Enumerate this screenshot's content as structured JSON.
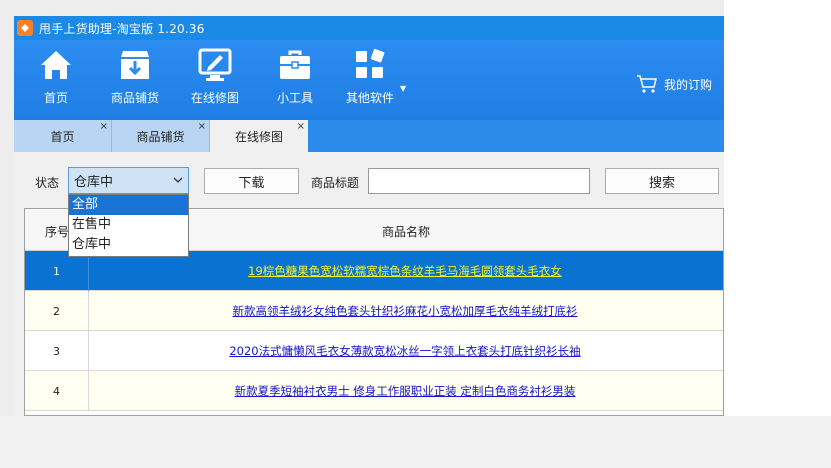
{
  "window": {
    "title": "甩手上货助理-淘宝版 1.20.36"
  },
  "toolbar": {
    "items": [
      {
        "label": "首页",
        "icon": "home-icon"
      },
      {
        "label": "商品铺货",
        "icon": "box-icon"
      },
      {
        "label": "在线修图",
        "icon": "monitor-edit-icon"
      },
      {
        "label": "小工具",
        "icon": "toolbox-icon"
      },
      {
        "label": "其他软件",
        "icon": "apps-icon"
      }
    ],
    "subscription": "我的订购"
  },
  "tabs": [
    {
      "label": "首页",
      "close": "×"
    },
    {
      "label": "商品铺货",
      "close": "×"
    },
    {
      "label": "在线修图",
      "close": "×"
    }
  ],
  "filter": {
    "status_label": "状态",
    "status_value": "仓库中",
    "status_options": [
      "全部",
      "在售中",
      "仓库中"
    ],
    "download_label": "下载",
    "title_label": "商品标题",
    "title_value": "",
    "search_label": "搜索"
  },
  "table": {
    "columns": [
      "序号",
      "商品名称"
    ],
    "rows": [
      {
        "index": "1",
        "name": "19棕色糖果色宽松软糯宽棕色条纹羊毛马海毛圆领套头毛衣女"
      },
      {
        "index": "2",
        "name": "新款高领羊绒衫女纯色套头针织衫麻花小宽松加厚毛衣纯羊绒打底衫"
      },
      {
        "index": "3",
        "name": "2020法式慵懒风毛衣女薄款宽松冰丝一字领上衣套头打底针织衫长袖"
      },
      {
        "index": "4",
        "name": "新款夏季短袖衬衣男士 修身工作服职业正装 定制白色商务衬衫男装"
      }
    ],
    "selected_row": 1
  },
  "colors": {
    "accent": "#1a8ae6",
    "selected_row": "#0a73d2",
    "link": "#1414c8"
  }
}
